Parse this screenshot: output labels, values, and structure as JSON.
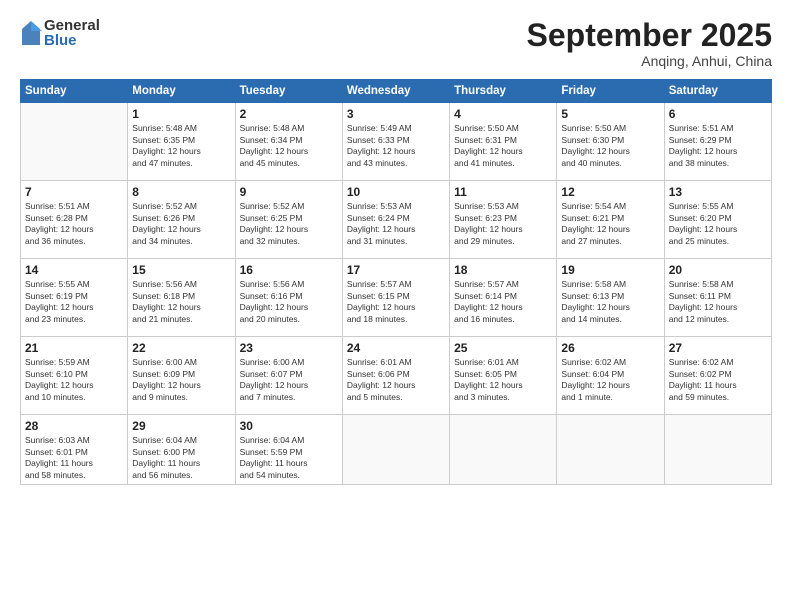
{
  "logo": {
    "general": "General",
    "blue": "Blue"
  },
  "header": {
    "month": "September 2025",
    "location": "Anqing, Anhui, China"
  },
  "weekdays": [
    "Sunday",
    "Monday",
    "Tuesday",
    "Wednesday",
    "Thursday",
    "Friday",
    "Saturday"
  ],
  "weeks": [
    [
      {
        "day": "",
        "info": ""
      },
      {
        "day": "1",
        "info": "Sunrise: 5:48 AM\nSunset: 6:35 PM\nDaylight: 12 hours\nand 47 minutes."
      },
      {
        "day": "2",
        "info": "Sunrise: 5:48 AM\nSunset: 6:34 PM\nDaylight: 12 hours\nand 45 minutes."
      },
      {
        "day": "3",
        "info": "Sunrise: 5:49 AM\nSunset: 6:33 PM\nDaylight: 12 hours\nand 43 minutes."
      },
      {
        "day": "4",
        "info": "Sunrise: 5:50 AM\nSunset: 6:31 PM\nDaylight: 12 hours\nand 41 minutes."
      },
      {
        "day": "5",
        "info": "Sunrise: 5:50 AM\nSunset: 6:30 PM\nDaylight: 12 hours\nand 40 minutes."
      },
      {
        "day": "6",
        "info": "Sunrise: 5:51 AM\nSunset: 6:29 PM\nDaylight: 12 hours\nand 38 minutes."
      }
    ],
    [
      {
        "day": "7",
        "info": "Sunrise: 5:51 AM\nSunset: 6:28 PM\nDaylight: 12 hours\nand 36 minutes."
      },
      {
        "day": "8",
        "info": "Sunrise: 5:52 AM\nSunset: 6:26 PM\nDaylight: 12 hours\nand 34 minutes."
      },
      {
        "day": "9",
        "info": "Sunrise: 5:52 AM\nSunset: 6:25 PM\nDaylight: 12 hours\nand 32 minutes."
      },
      {
        "day": "10",
        "info": "Sunrise: 5:53 AM\nSunset: 6:24 PM\nDaylight: 12 hours\nand 31 minutes."
      },
      {
        "day": "11",
        "info": "Sunrise: 5:53 AM\nSunset: 6:23 PM\nDaylight: 12 hours\nand 29 minutes."
      },
      {
        "day": "12",
        "info": "Sunrise: 5:54 AM\nSunset: 6:21 PM\nDaylight: 12 hours\nand 27 minutes."
      },
      {
        "day": "13",
        "info": "Sunrise: 5:55 AM\nSunset: 6:20 PM\nDaylight: 12 hours\nand 25 minutes."
      }
    ],
    [
      {
        "day": "14",
        "info": "Sunrise: 5:55 AM\nSunset: 6:19 PM\nDaylight: 12 hours\nand 23 minutes."
      },
      {
        "day": "15",
        "info": "Sunrise: 5:56 AM\nSunset: 6:18 PM\nDaylight: 12 hours\nand 21 minutes."
      },
      {
        "day": "16",
        "info": "Sunrise: 5:56 AM\nSunset: 6:16 PM\nDaylight: 12 hours\nand 20 minutes."
      },
      {
        "day": "17",
        "info": "Sunrise: 5:57 AM\nSunset: 6:15 PM\nDaylight: 12 hours\nand 18 minutes."
      },
      {
        "day": "18",
        "info": "Sunrise: 5:57 AM\nSunset: 6:14 PM\nDaylight: 12 hours\nand 16 minutes."
      },
      {
        "day": "19",
        "info": "Sunrise: 5:58 AM\nSunset: 6:13 PM\nDaylight: 12 hours\nand 14 minutes."
      },
      {
        "day": "20",
        "info": "Sunrise: 5:58 AM\nSunset: 6:11 PM\nDaylight: 12 hours\nand 12 minutes."
      }
    ],
    [
      {
        "day": "21",
        "info": "Sunrise: 5:59 AM\nSunset: 6:10 PM\nDaylight: 12 hours\nand 10 minutes."
      },
      {
        "day": "22",
        "info": "Sunrise: 6:00 AM\nSunset: 6:09 PM\nDaylight: 12 hours\nand 9 minutes."
      },
      {
        "day": "23",
        "info": "Sunrise: 6:00 AM\nSunset: 6:07 PM\nDaylight: 12 hours\nand 7 minutes."
      },
      {
        "day": "24",
        "info": "Sunrise: 6:01 AM\nSunset: 6:06 PM\nDaylight: 12 hours\nand 5 minutes."
      },
      {
        "day": "25",
        "info": "Sunrise: 6:01 AM\nSunset: 6:05 PM\nDaylight: 12 hours\nand 3 minutes."
      },
      {
        "day": "26",
        "info": "Sunrise: 6:02 AM\nSunset: 6:04 PM\nDaylight: 12 hours\nand 1 minute."
      },
      {
        "day": "27",
        "info": "Sunrise: 6:02 AM\nSunset: 6:02 PM\nDaylight: 11 hours\nand 59 minutes."
      }
    ],
    [
      {
        "day": "28",
        "info": "Sunrise: 6:03 AM\nSunset: 6:01 PM\nDaylight: 11 hours\nand 58 minutes."
      },
      {
        "day": "29",
        "info": "Sunrise: 6:04 AM\nSunset: 6:00 PM\nDaylight: 11 hours\nand 56 minutes."
      },
      {
        "day": "30",
        "info": "Sunrise: 6:04 AM\nSunset: 5:59 PM\nDaylight: 11 hours\nand 54 minutes."
      },
      {
        "day": "",
        "info": ""
      },
      {
        "day": "",
        "info": ""
      },
      {
        "day": "",
        "info": ""
      },
      {
        "day": "",
        "info": ""
      }
    ]
  ]
}
